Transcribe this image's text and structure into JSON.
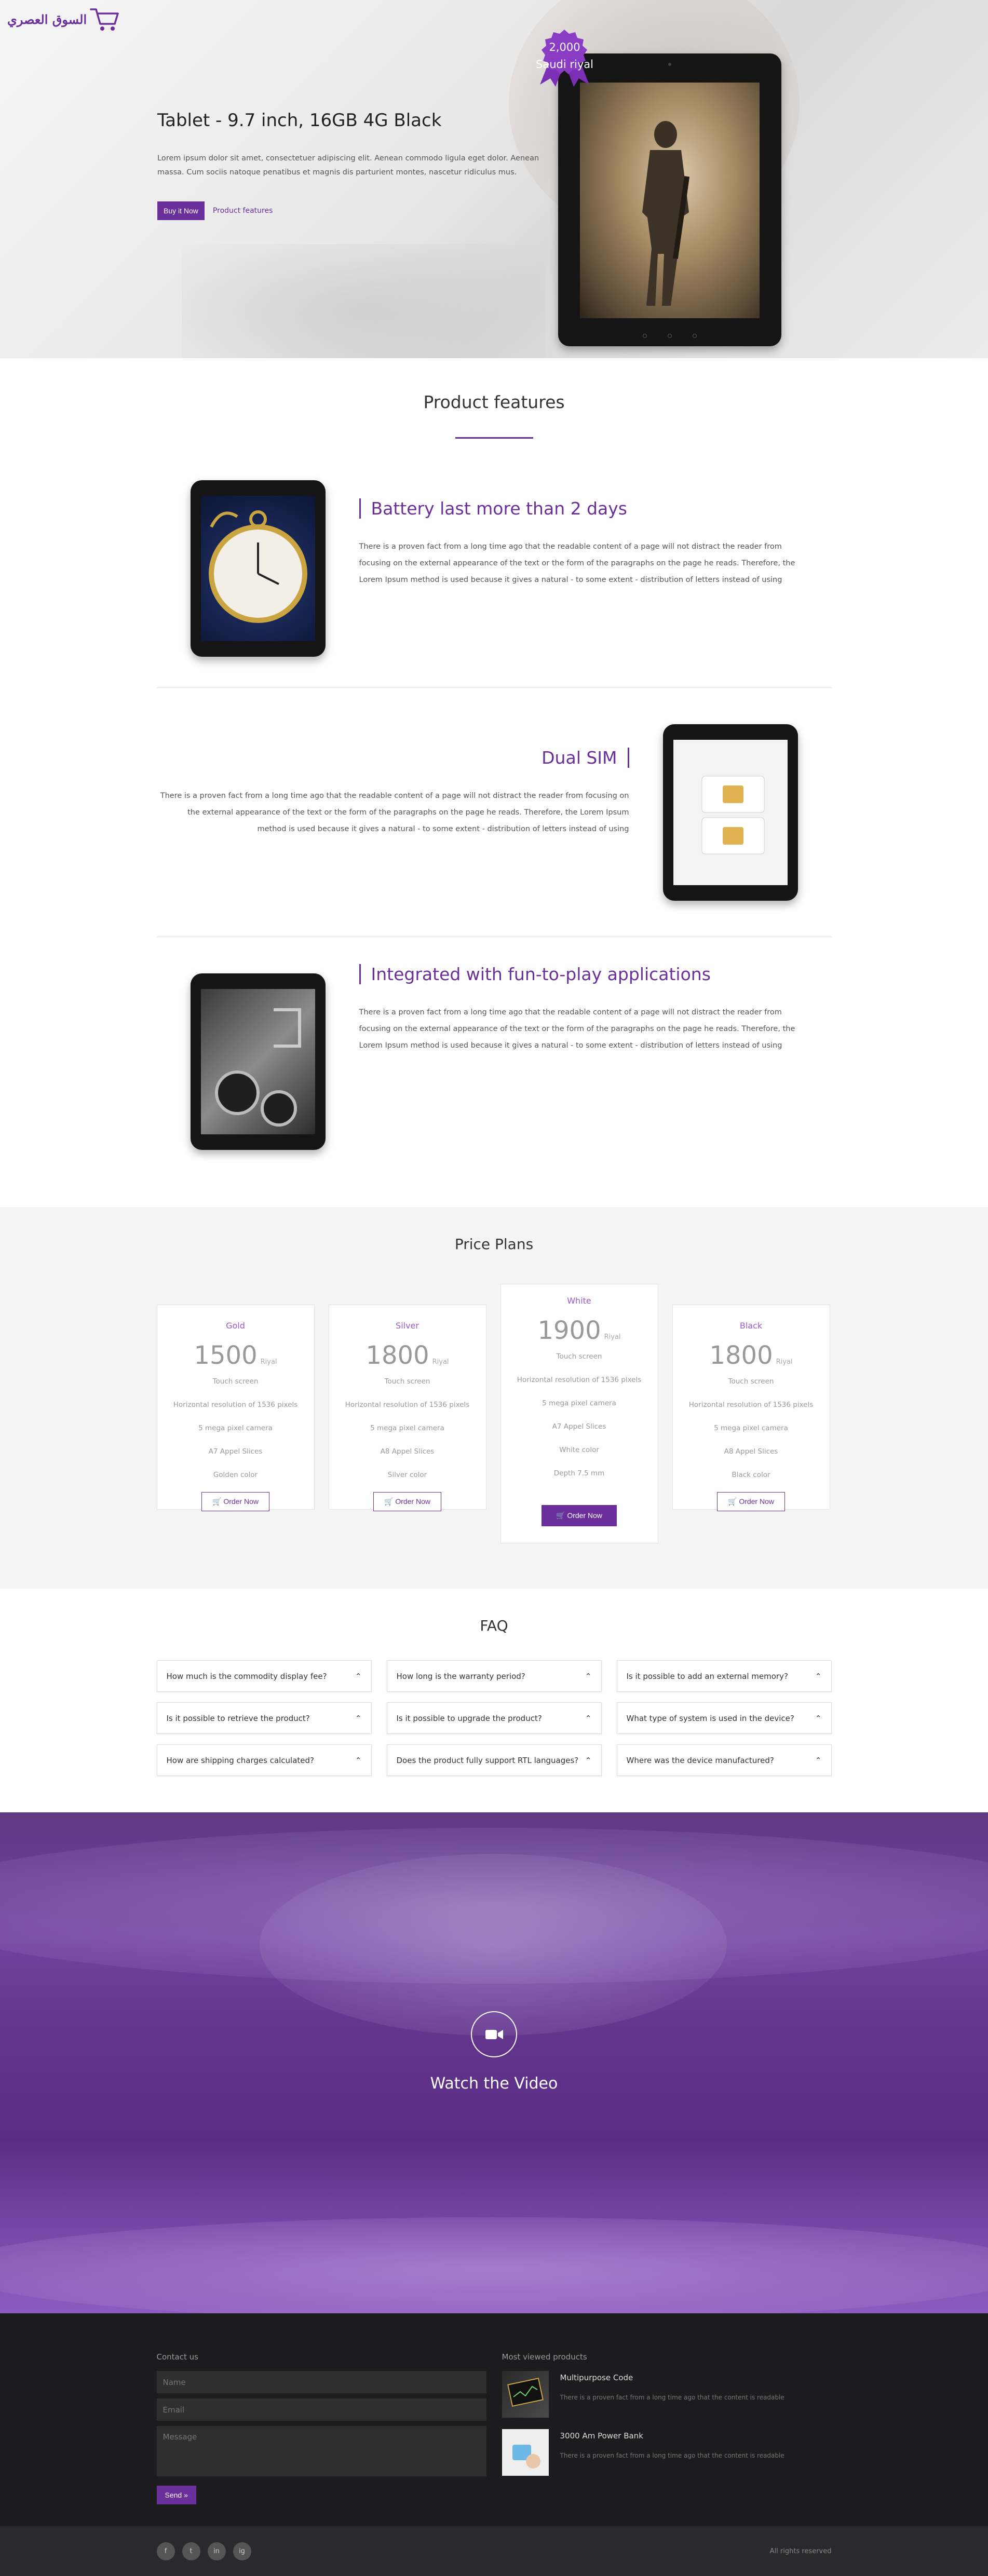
{
  "brand": {
    "logo_text": "السوق العصري",
    "accent_color": "#6b2f9c"
  },
  "hero": {
    "badge_amount": "2,000",
    "badge_currency": "Saudi riyal",
    "title": "Tablet - 9.7 inch, 16GB 4G Black",
    "description": "Lorem ipsum dolor sit amet, consectetuer adipiscing elit. Aenean commodo ligula eget dolor. Aenean massa. Cum sociis natoque penatibus et magnis dis parturient montes, nascetur ridiculus mus.",
    "buy_label": "Buy it Now",
    "features_link": "Product features"
  },
  "features": {
    "title": "Product features",
    "items": [
      {
        "heading": "Battery last more than 2 days",
        "body": "There is a proven fact from a long time ago that the readable content of a page will not distract the reader from focusing on the external appearance of the text or the form of the paragraphs on the page he reads. Therefore, the Lorem Ipsum method is used because it gives a natural - to some extent - distribution of letters instead of using"
      },
      {
        "heading": "Dual SIM",
        "body": "There is a proven fact from a long time ago that the readable content of a page will not distract the reader from focusing on the external appearance of the text or the form of the paragraphs on the page he reads. Therefore, the Lorem Ipsum method is used because it gives a natural - to some extent - distribution of letters instead of using"
      },
      {
        "heading": "Integrated with fun-to-play applications",
        "body": "There is a proven fact from a long time ago that the readable content of a page will not distract the reader from focusing on the external appearance of the text or the form of the paragraphs on the page he reads. Therefore, the Lorem Ipsum method is used because it gives a natural - to some extent - distribution of letters instead of using"
      }
    ]
  },
  "pricing": {
    "title": "Price Plans",
    "plans": [
      {
        "name": "Gold",
        "price": "1500",
        "currency": "Riyal",
        "rows": [
          "Touch screen",
          "Horizontal resolution of 1536 pixels",
          "5 mega pixel camera",
          "A7 Appel Slices",
          "Golden color"
        ],
        "button": "Order Now"
      },
      {
        "name": "Silver",
        "price": "1800",
        "currency": "Riyal",
        "rows": [
          "Touch screen",
          "Horizontal resolution of 1536 pixels",
          "5 mega pixel camera",
          "A8 Appel Slices",
          "Silver color"
        ],
        "button": "Order Now"
      },
      {
        "name": "White",
        "price": "1900",
        "currency": "Riyal",
        "rows": [
          "Touch screen",
          "Horizontal resolution of 1536 pixels",
          "5 mega pixel camera",
          "A7 Appel Slices",
          "White color",
          "Depth 7.5 mm"
        ],
        "button": "Order Now"
      },
      {
        "name": "Black",
        "price": "1800",
        "currency": "Riyal",
        "rows": [
          "Touch screen",
          "Horizontal resolution of 1536 pixels",
          "5 mega pixel camera",
          "A8 Appel Slices",
          "Black color"
        ],
        "button": "Order Now"
      }
    ]
  },
  "faq": {
    "title": "FAQ",
    "items": [
      "How much is the commodity display fee?",
      "How long is the warranty period?",
      "Is it possible to add an external memory?",
      "Is it possible to retrieve the product?",
      "Is it possible to upgrade the product?",
      "What type of system is used in the device?",
      "How are shipping charges calculated?",
      "Does the product fully support RTL languages?",
      "Where was the device manufactured?"
    ]
  },
  "video": {
    "label": "Watch the Video"
  },
  "footer": {
    "contact_title": "Contact us",
    "name_placeholder": "Name",
    "email_placeholder": "Email",
    "message_placeholder": "Message",
    "send_label": "Send",
    "products_title": "Most viewed products",
    "products": [
      {
        "title": "Multipurpose Code",
        "desc": "There is a proven fact from a long time ago that the content is readable"
      },
      {
        "title": "3000 Am Power Bank",
        "desc": "There is a proven fact from a long time ago that the content is readable"
      }
    ],
    "socials": [
      "f",
      "t",
      "in",
      "ig"
    ],
    "rights": "All rights reserved"
  }
}
